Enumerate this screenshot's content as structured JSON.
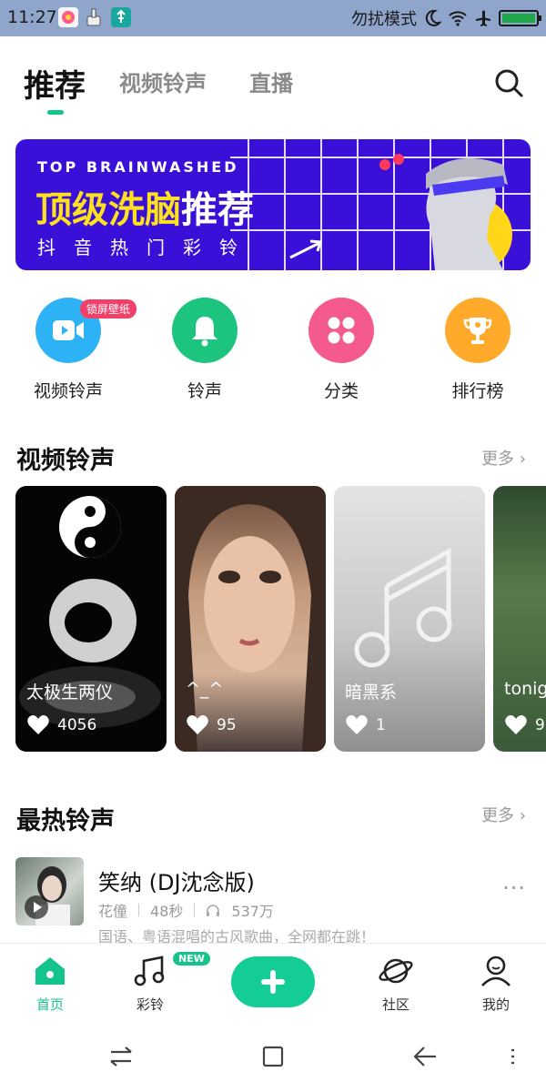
{
  "status_bar": {
    "time": "11:27",
    "dnd_text": "勿扰模式",
    "battery_level": 1.0
  },
  "tabs": [
    {
      "label": "推荐",
      "active": true
    },
    {
      "label": "视频铃声",
      "active": false
    },
    {
      "label": "直播",
      "active": false
    }
  ],
  "banner": {
    "english": "TOP BRAINWASHED",
    "title_highlight": "顶级洗脑",
    "title_rest": "推荐",
    "subtitle": "抖音热门彩铃"
  },
  "shortcuts": [
    {
      "label": "视频铃声",
      "icon": "video-icon",
      "color": "#2db3f5",
      "badge": "锁屏壁纸"
    },
    {
      "label": "铃声",
      "icon": "bell-icon",
      "color": "#1cc47e"
    },
    {
      "label": "分类",
      "icon": "grid-icon",
      "color": "#f55a8c"
    },
    {
      "label": "排行榜",
      "icon": "trophy-icon",
      "color": "#ffaa2a"
    }
  ],
  "video_section": {
    "title": "视频铃声",
    "more": "更多"
  },
  "video_cards": [
    {
      "title": "太极生两仪",
      "likes": "4056"
    },
    {
      "title": "^_^",
      "likes": "95"
    },
    {
      "title": "暗黑系",
      "likes": "1"
    },
    {
      "title": "tonig",
      "likes": "9"
    }
  ],
  "hot_section": {
    "title": "最热铃声",
    "more": "更多"
  },
  "hot_songs": [
    {
      "title": "笑纳 (DJ沈念版)",
      "artist": "花僮",
      "duration": "48秒",
      "plays": "537万",
      "description": "国语、粤语混唱的古风歌曲，全网都在跳！"
    }
  ],
  "bottom_nav": {
    "items": [
      {
        "label": "首页",
        "icon": "home-icon",
        "active": true
      },
      {
        "label": "彩铃",
        "icon": "music-note-icon",
        "active": false,
        "badge": "NEW"
      },
      {
        "label": "社区",
        "icon": "planet-icon",
        "active": false
      },
      {
        "label": "我的",
        "icon": "user-icon",
        "active": false
      }
    ]
  },
  "colors": {
    "accent": "#14c48c",
    "banner_bg": "#3a10d8",
    "banner_yellow": "#ffe21d"
  }
}
